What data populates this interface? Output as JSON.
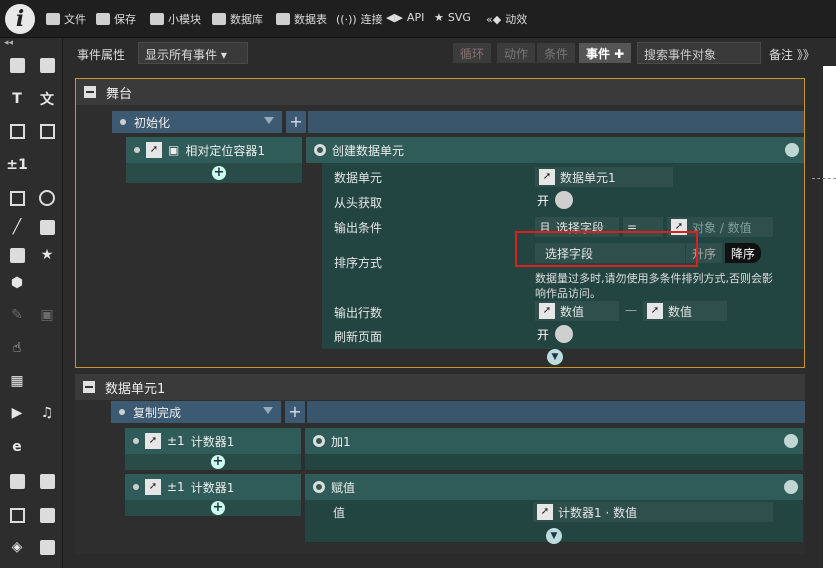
{
  "topbar": {
    "items": [
      {
        "label": "文件"
      },
      {
        "label": "保存"
      },
      {
        "label": "小模块"
      },
      {
        "label": "数据库"
      },
      {
        "label": "数据表"
      },
      {
        "label": "连接"
      },
      {
        "label": "API"
      },
      {
        "label": "SVG"
      },
      {
        "label": "动效"
      }
    ]
  },
  "toolbar": {
    "title": "事件属性",
    "filter": "显示所有事件",
    "tags": [
      "循环",
      "动作",
      "条件",
      "事件 ✚"
    ],
    "search_placeholder": "搜索事件对象",
    "notes": "备注",
    "notes_icon": "》》"
  },
  "leftbar": {
    "collapse": "◂◂"
  },
  "stage": {
    "title": "舞台",
    "trigger": "初始化",
    "object": "相对定位容器1",
    "action": "创建数据单元",
    "rows": {
      "data_unit_label": "数据单元",
      "data_unit_value": "数据单元1",
      "from_start_label": "从头获取",
      "from_start_value": "开",
      "output_cond_label": "输出条件",
      "and": "且",
      "select_field": "选择字段",
      "eq": "=",
      "obj_value": "对象 / 数值",
      "sort_label": "排序方式",
      "sort_field": "选择字段",
      "asc": "升序",
      "desc": "降序",
      "hint": "数据量过多时,请勿使用多条件排列方式,否则会影响作品访问。",
      "output_rows_label": "输出行数",
      "num1": "数值",
      "dash": "—",
      "num2": "数值",
      "refresh_label": "刷新页面",
      "refresh_value": "开"
    }
  },
  "unit": {
    "title": "数据单元1",
    "trigger": "复制完成",
    "events": [
      {
        "pm": "±1",
        "object": "计数器1",
        "action": "加1"
      },
      {
        "pm": "±1",
        "object": "计数器1",
        "action": "赋值",
        "field_label": "值",
        "field_value": "计数器1 · 数值"
      }
    ]
  }
}
